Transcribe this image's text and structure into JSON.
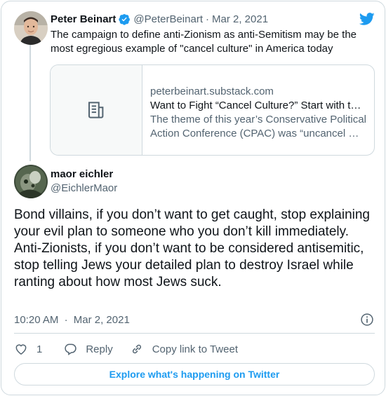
{
  "quoted_tweet": {
    "display_name": "Peter Beinart",
    "handle": "@PeterBeinart",
    "separator": "·",
    "date": "Mar 2, 2021",
    "text": "The campaign to define anti-Zionism as anti-Semitism may be the most egregious example of \"cancel culture\" in America today",
    "link_card": {
      "domain": "peterbeinart.substack.com",
      "title": "Want to Fight “Cancel Culture?” Start with t…",
      "description": "The theme of this year’s Conservative Political Action Conference (CPAC) was “uncancel …"
    }
  },
  "tweet": {
    "display_name": "maor eichler",
    "handle": "@EichlerMaor",
    "text_lines": [
      "Bond villains, if you don’t want to get caught, stop explaining your evil plan to someone who you don’t kill immediately.",
      "Anti-Zionists, if you don’t want to be considered antisemitic, stop telling Jews your detailed plan to destroy Israel while ranting about how most Jews suck."
    ],
    "time": "10:20 AM",
    "separator": "·",
    "date": "Mar 2, 2021"
  },
  "actions": {
    "like_count": "1",
    "reply_label": "Reply",
    "copy_link_label": "Copy link to Tweet"
  },
  "explore_label": "Explore what's happening on Twitter",
  "icons": {
    "brand": "twitter-bird-icon",
    "verified": "verified-badge-icon",
    "article": "article-icon",
    "info": "info-icon",
    "like": "heart-icon",
    "reply": "reply-bubble-icon",
    "link": "link-icon"
  },
  "colors": {
    "brand_blue": "#1d9bf0",
    "text_primary": "#0f1419",
    "text_secondary": "#536471",
    "border": "#cfd9de"
  }
}
